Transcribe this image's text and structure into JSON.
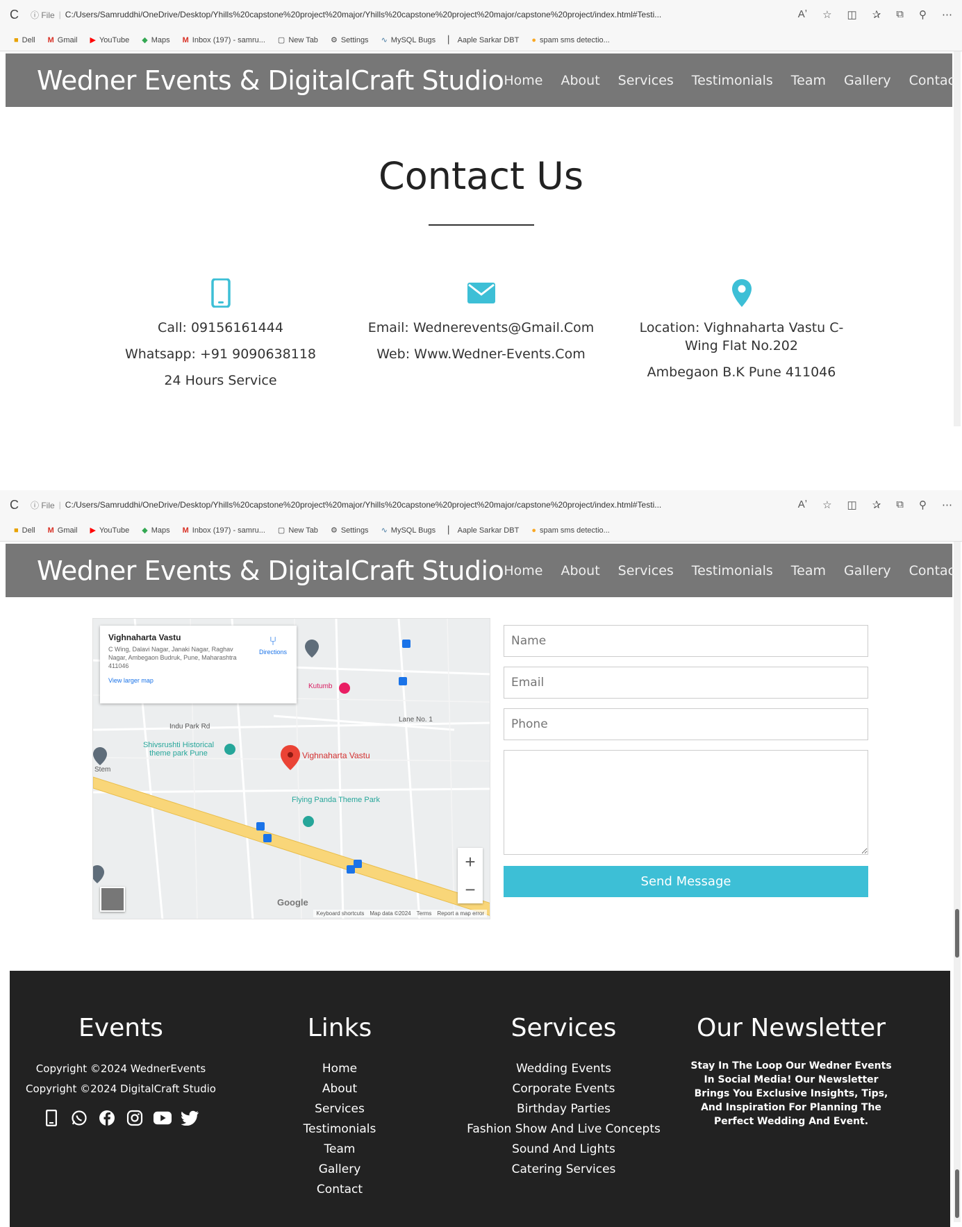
{
  "browser": {
    "reload": "C",
    "info": "ⓘ File",
    "url": "C:/Users/Samruddhi/OneDrive/Desktop/Yhills%20capstone%20project%20major/Yhills%20capstone%20project%20major/capstone%20project/index.html#Testi...",
    "bookmarks": [
      "Dell",
      "Gmail",
      "YouTube",
      "Maps",
      "Inbox (197) - samru...",
      "New Tab",
      "Settings",
      "MySQL Bugs",
      "Aaple Sarkar DBT",
      "spam sms detectio..."
    ]
  },
  "nav": {
    "brand": "Wedner Events & DigitalCraft Studio",
    "links": [
      "Home",
      "About",
      "Services",
      "Testimonials",
      "Team",
      "Gallery",
      "Contact"
    ]
  },
  "contact": {
    "title": "Contact Us",
    "col1": [
      "Call: 09156161444",
      "Whatsapp: +91 9090638118",
      "24 Hours Service"
    ],
    "col2": [
      "Email: Wednerevents@Gmail.Com",
      "Web: Www.Wedner-Events.Com"
    ],
    "col3": [
      "Location: Vighnaharta Vastu C-Wing Flat No.202",
      "Ambegaon B.K Pune 411046"
    ]
  },
  "map": {
    "place_name": "Vighnaharta Vastu",
    "address": "C Wing, Dalavi Nagar, Janaki Nagar, Raghav Nagar, Ambegaon Budruk, Pune, Maharashtra 411046",
    "directions": "Directions",
    "larger": "View larger map",
    "labels": {
      "kutumb": "Kutumb",
      "indu": "Indu Park Rd",
      "lane": "Lane No. 1",
      "shiv": "Shivsrushti Historical theme park Pune",
      "vv": "Vighnaharta Vastu",
      "flying": "Flying Panda Theme Park",
      "stem": "Stem",
      "google": "Google"
    },
    "footer": [
      "Keyboard shortcuts",
      "Map data ©2024",
      "Terms",
      "Report a map error"
    ]
  },
  "form": {
    "name_ph": "Name",
    "email_ph": "Email",
    "phone_ph": "Phone",
    "send": "Send Message"
  },
  "footer": {
    "events_title": "Events",
    "copy1": "Copyright ©2024 WednerEvents",
    "copy2": "Copyright ©2024 DigitalCraft Studio",
    "links_title": "Links",
    "links": [
      "Home",
      "About",
      "Services",
      "Testimonials",
      "Team",
      "Gallery",
      "Contact"
    ],
    "services_title": "Services",
    "services": [
      "Wedding Events",
      "Corporate Events",
      "Birthday Parties",
      "Fashion Show And Live Concepts",
      "Sound And Lights",
      "Catering Services"
    ],
    "news_title": "Our Newsletter",
    "news_text": "Stay In The Loop Our Wedner Events In Social Media! Our Newsletter Brings You Exclusive Insights, Tips, And Inspiration For Planning The Perfect Wedding And Event."
  },
  "colors": {
    "accent": "#3dbfd6",
    "navbar": "#777777",
    "footer": "#222222"
  }
}
